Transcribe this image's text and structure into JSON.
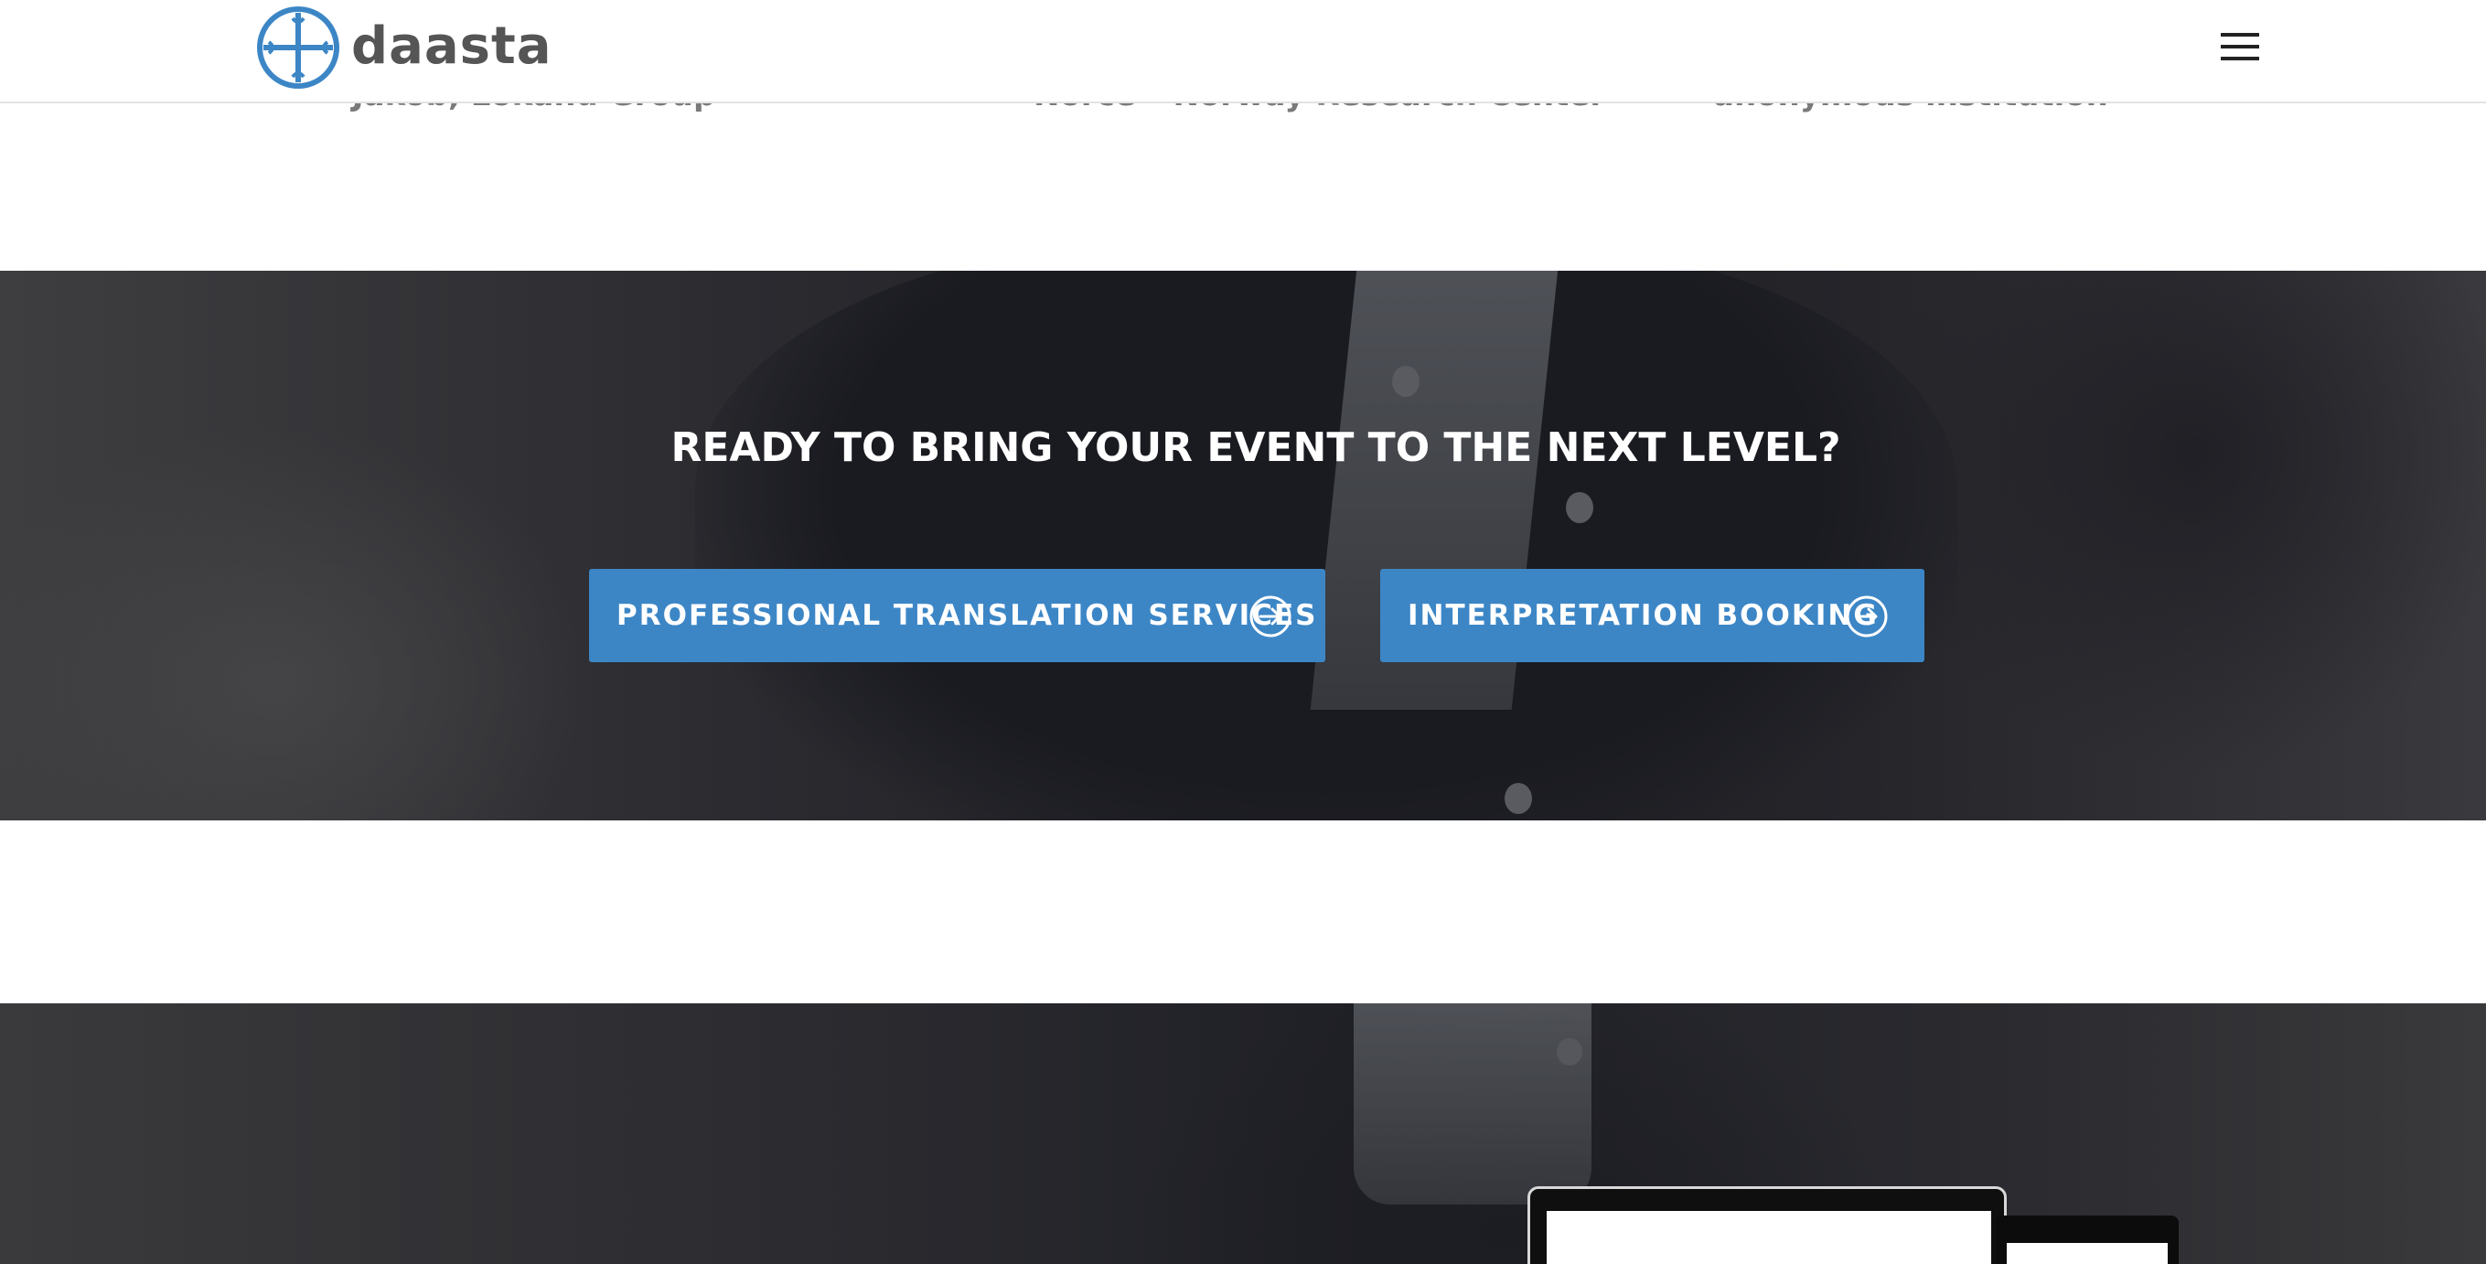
{
  "header": {
    "logo_text": "daasta",
    "menu_icon": "hamburger-menu-icon"
  },
  "testimonials": {
    "attributions": [
      "Jakob, Lokand Group",
      "Norce – Norway Research Center",
      "anonymous institution"
    ]
  },
  "cta": {
    "title": "READY TO BRING YOUR EVENT TO THE NEXT LEVEL?",
    "buttons": [
      {
        "label": "PROFESSIONAL TRANSLATION SERVICES",
        "icon": "arrow-right-circle-icon"
      },
      {
        "label": "INTERPRETATION BOOKING",
        "icon": "arrow-right-circle-icon"
      }
    ]
  },
  "colors": {
    "accent": "#3c86c6",
    "header_bg": "#ffffff",
    "logo_text": "#555555",
    "dark_overlay": "#1d1d22"
  }
}
